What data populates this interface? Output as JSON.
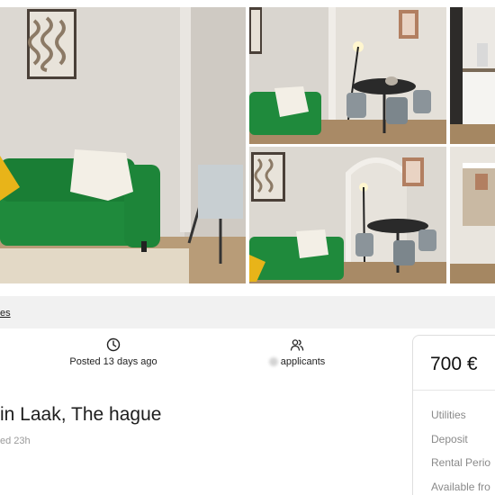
{
  "gallery": {
    "photos": [
      {
        "name": "living-room-green-sofa"
      },
      {
        "name": "living-room-dining-area"
      },
      {
        "name": "kitchen"
      },
      {
        "name": "living-room-arch-dining"
      },
      {
        "name": "kitchen-doorway"
      }
    ]
  },
  "tabs": {
    "active_label": "es"
  },
  "stats": {
    "posted_label": "Posted 13 days ago",
    "posted_icon": "clock-icon",
    "applicants_label": "applicants",
    "applicants_icon": "users-icon"
  },
  "listing": {
    "title": "in Laak, The hague",
    "subtitle": "ed 23h"
  },
  "price_card": {
    "price": "700 €",
    "details": [
      "Utilities",
      "Deposit",
      "Rental Perio",
      "Available fro"
    ]
  },
  "colors": {
    "sofa_green": "#1f8a3c",
    "pillow_yellow": "#e8b419",
    "tab_bar_bg": "#f1f1f1",
    "muted_text": "#8a8a8a"
  }
}
